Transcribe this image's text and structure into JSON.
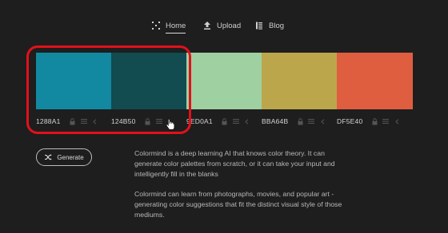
{
  "nav": {
    "home": {
      "label": "Home",
      "icon": "generate-grid-icon"
    },
    "upload": {
      "label": "Upload",
      "icon": "upload-icon"
    },
    "blog": {
      "label": "Blog",
      "icon": "blog-list-icon"
    }
  },
  "palette": {
    "swatches": [
      {
        "code": "1288A1",
        "color": "#1288A1"
      },
      {
        "code": "124B50",
        "color": "#124B50"
      },
      {
        "code": "9ED0A1",
        "color": "#9ED0A1"
      },
      {
        "code": "BBA64B",
        "color": "#BBA64B"
      },
      {
        "code": "DF5E40",
        "color": "#DF5E40"
      }
    ]
  },
  "highlight_color": "#e3101a",
  "generate_button": {
    "label": "Generate",
    "icon": "shuffle-icon"
  },
  "description": {
    "p1": "Colormind is a deep learning AI that knows color theory. It can generate color palettes from scratch, or it can take your input and intelligently fill in the blanks",
    "p2": "Colormind can learn from photographs, movies, and popular art - generating color suggestions that fit the distinct visual style of those mediums."
  }
}
